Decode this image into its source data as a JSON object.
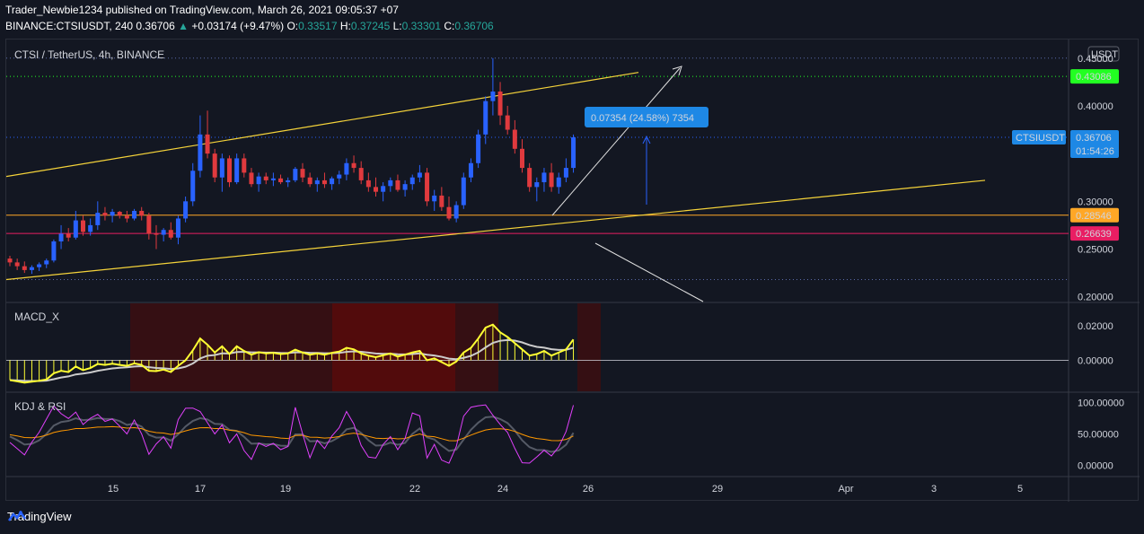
{
  "header": {
    "publisher_line": "Trader_Newbie1234 published on TradingView.com, March 26, 2021 09:05:37 +07",
    "symbol": "BINANCE:CTSIUSDT, 240",
    "last": "0.36706",
    "arrow": "▲",
    "change": "+0.03174 (+9.47%)",
    "o_label": "O:",
    "o": "0.33517",
    "h_label": "H:",
    "h": "0.37245",
    "l_label": "L:",
    "l": "0.33301",
    "c_label": "C:",
    "c": "0.36706"
  },
  "footer": {
    "brand": "TradingView"
  },
  "colors": {
    "up": "#2962ff",
    "down": "#e03a3e",
    "accent_green": "#22ff22",
    "orange": "#ffa726",
    "pink": "#e91e63",
    "yellow": "#ffff33",
    "blue_label": "#1e88e5"
  },
  "chart_data": [
    {
      "type": "candlestick",
      "title": "CTSI / TetherUS, 4h, BINANCE",
      "currency": "USDT",
      "y_ticks": [
        "0.45000",
        "0.40000",
        "0.30000",
        "0.25000",
        "0.20000"
      ],
      "y_tick_values": [
        0.45,
        0.4,
        0.3,
        0.25,
        0.2
      ],
      "ylim": [
        0.195,
        0.462
      ],
      "x_ticks": [
        "15",
        "17",
        "19",
        "22",
        "24",
        "26",
        "29",
        "Apr",
        "3",
        "5"
      ],
      "price_labels": [
        {
          "text": "0.43086",
          "value": 0.43086,
          "color": "#22ff22"
        },
        {
          "text": "0.28546",
          "value": 0.28546,
          "color": "#ffa726"
        },
        {
          "text": "0.26639",
          "value": 0.26639,
          "color": "#e91e63"
        }
      ],
      "last_price": {
        "symbol": "CTSIUSDT",
        "price": "0.36706",
        "countdown": "01:54:26",
        "value": 0.36706
      },
      "measure_label": "0.07354 (24.58%) 7354",
      "candles": [
        [
          0.24,
          0.243,
          0.232,
          0.236
        ],
        [
          0.236,
          0.24,
          0.228,
          0.232
        ],
        [
          0.232,
          0.237,
          0.225,
          0.228
        ],
        [
          0.228,
          0.233,
          0.224,
          0.231
        ],
        [
          0.231,
          0.236,
          0.227,
          0.234
        ],
        [
          0.234,
          0.24,
          0.23,
          0.238
        ],
        [
          0.238,
          0.26,
          0.236,
          0.258
        ],
        [
          0.258,
          0.275,
          0.25,
          0.266
        ],
        [
          0.266,
          0.272,
          0.258,
          0.262
        ],
        [
          0.262,
          0.29,
          0.26,
          0.28
        ],
        [
          0.28,
          0.285,
          0.264,
          0.268
        ],
        [
          0.268,
          0.282,
          0.264,
          0.275
        ],
        [
          0.275,
          0.3,
          0.27,
          0.288
        ],
        [
          0.288,
          0.294,
          0.28,
          0.285
        ],
        [
          0.285,
          0.292,
          0.278,
          0.289
        ],
        [
          0.289,
          0.29,
          0.282,
          0.285
        ],
        [
          0.285,
          0.29,
          0.278,
          0.282
        ],
        [
          0.282,
          0.292,
          0.28,
          0.29
        ],
        [
          0.29,
          0.294,
          0.28,
          0.285
        ],
        [
          0.285,
          0.288,
          0.26,
          0.266
        ],
        [
          0.266,
          0.275,
          0.25,
          0.265
        ],
        [
          0.265,
          0.272,
          0.258,
          0.27
        ],
        [
          0.27,
          0.278,
          0.26,
          0.262
        ],
        [
          0.262,
          0.285,
          0.255,
          0.282
        ],
        [
          0.282,
          0.305,
          0.278,
          0.3
        ],
        [
          0.3,
          0.34,
          0.295,
          0.332
        ],
        [
          0.332,
          0.39,
          0.325,
          0.37
        ],
        [
          0.37,
          0.395,
          0.345,
          0.35
        ],
        [
          0.35,
          0.355,
          0.32,
          0.325
        ],
        [
          0.325,
          0.35,
          0.31,
          0.345
        ],
        [
          0.345,
          0.348,
          0.315,
          0.32
        ],
        [
          0.32,
          0.35,
          0.318,
          0.345
        ],
        [
          0.345,
          0.35,
          0.325,
          0.33
        ],
        [
          0.33,
          0.335,
          0.315,
          0.318
        ],
        [
          0.318,
          0.33,
          0.31,
          0.326
        ],
        [
          0.326,
          0.33,
          0.318,
          0.322
        ],
        [
          0.322,
          0.33,
          0.316,
          0.324
        ],
        [
          0.324,
          0.328,
          0.318,
          0.32
        ],
        [
          0.32,
          0.325,
          0.315,
          0.322
        ],
        [
          0.322,
          0.336,
          0.32,
          0.334
        ],
        [
          0.334,
          0.34,
          0.32,
          0.325
        ],
        [
          0.325,
          0.33,
          0.315,
          0.318
        ],
        [
          0.318,
          0.325,
          0.31,
          0.322
        ],
        [
          0.322,
          0.33,
          0.314,
          0.318
        ],
        [
          0.318,
          0.326,
          0.312,
          0.324
        ],
        [
          0.324,
          0.332,
          0.318,
          0.328
        ],
        [
          0.328,
          0.345,
          0.322,
          0.34
        ],
        [
          0.34,
          0.348,
          0.33,
          0.335
        ],
        [
          0.335,
          0.342,
          0.318,
          0.322
        ],
        [
          0.322,
          0.33,
          0.31,
          0.315
        ],
        [
          0.315,
          0.325,
          0.305,
          0.31
        ],
        [
          0.31,
          0.32,
          0.3,
          0.316
        ],
        [
          0.316,
          0.325,
          0.31,
          0.322
        ],
        [
          0.322,
          0.328,
          0.31,
          0.312
        ],
        [
          0.312,
          0.322,
          0.305,
          0.318
        ],
        [
          0.318,
          0.328,
          0.312,
          0.325
        ],
        [
          0.325,
          0.338,
          0.32,
          0.33
        ],
        [
          0.33,
          0.335,
          0.295,
          0.3
        ],
        [
          0.3,
          0.312,
          0.29,
          0.306
        ],
        [
          0.306,
          0.315,
          0.29,
          0.294
        ],
        [
          0.294,
          0.305,
          0.28,
          0.282
        ],
        [
          0.282,
          0.3,
          0.278,
          0.296
        ],
        [
          0.296,
          0.33,
          0.292,
          0.325
        ],
        [
          0.325,
          0.345,
          0.32,
          0.34
        ],
        [
          0.34,
          0.375,
          0.335,
          0.37
        ],
        [
          0.37,
          0.41,
          0.36,
          0.405
        ],
        [
          0.405,
          0.45,
          0.39,
          0.415
        ],
        [
          0.415,
          0.425,
          0.38,
          0.39
        ],
        [
          0.39,
          0.4,
          0.37,
          0.375
        ],
        [
          0.375,
          0.385,
          0.35,
          0.355
        ],
        [
          0.355,
          0.365,
          0.33,
          0.335
        ],
        [
          0.335,
          0.34,
          0.31,
          0.315
        ],
        [
          0.315,
          0.325,
          0.3,
          0.32
        ],
        [
          0.32,
          0.335,
          0.31,
          0.33
        ],
        [
          0.33,
          0.34,
          0.31,
          0.315
        ],
        [
          0.315,
          0.33,
          0.308,
          0.325
        ],
        [
          0.325,
          0.345,
          0.32,
          0.335
        ],
        [
          0.335,
          0.37,
          0.33,
          0.367
        ]
      ]
    },
    {
      "type": "line",
      "title": "MACD_X",
      "y_ticks": [
        "0.02000",
        "0.00000"
      ],
      "y_tick_values": [
        0.02,
        0.0
      ],
      "ylim": [
        -0.018,
        0.033
      ]
    },
    {
      "type": "line",
      "title": "KDJ & RSI",
      "y_ticks": [
        "100.00000",
        "50.00000",
        "0.00000"
      ],
      "y_tick_values": [
        100,
        50,
        0
      ],
      "ylim": [
        -15,
        115
      ]
    }
  ]
}
